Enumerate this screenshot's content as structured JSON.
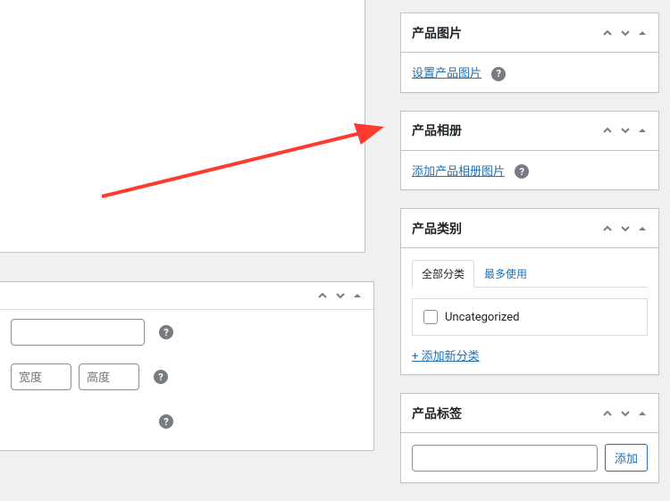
{
  "sidebar": {
    "product_image": {
      "title": "产品图片",
      "set_link": "设置产品图片"
    },
    "product_gallery": {
      "title": "产品相册",
      "add_link": "添加产品相册图片"
    },
    "categories": {
      "title": "产品类别",
      "tab_all": "全部分类",
      "tab_most": "最多使用",
      "item_uncat": "Uncategorized",
      "add_new": "+ 添加新分类"
    },
    "tags": {
      "title": "产品标签",
      "add_btn": "添加"
    }
  },
  "main": {
    "dim_width_ph": "宽度",
    "dim_height_ph": "高度"
  },
  "colors": {
    "link": "#2271b1",
    "arrow": "#ff3b30"
  }
}
